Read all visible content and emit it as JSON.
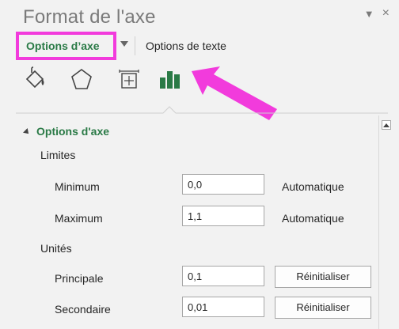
{
  "pane": {
    "title": "Format de l'axe",
    "close_label": "×"
  },
  "tabs": {
    "axis_label": "Options d’axe",
    "text_label": "Options de texte"
  },
  "icons": [
    "fill-line-icon",
    "effects-icon",
    "size-properties-icon",
    "axis-options-icon"
  ],
  "section": {
    "title": "Options d'axe",
    "limits_label": "Limites",
    "minimum_label": "Minimum",
    "minimum_value": "0,0",
    "minimum_auto": "Automatique",
    "maximum_label": "Maximum",
    "maximum_value": "1,1",
    "maximum_auto": "Automatique",
    "units_label": "Unités",
    "major_label": "Principale",
    "major_value": "0,1",
    "major_reset": "Réinitialiser",
    "minor_label": "Secondaire",
    "minor_value": "0,01",
    "minor_reset": "Réinitialiser"
  },
  "colors": {
    "accent_green": "#2a7a46",
    "highlight_pink": "#f23bdc"
  }
}
